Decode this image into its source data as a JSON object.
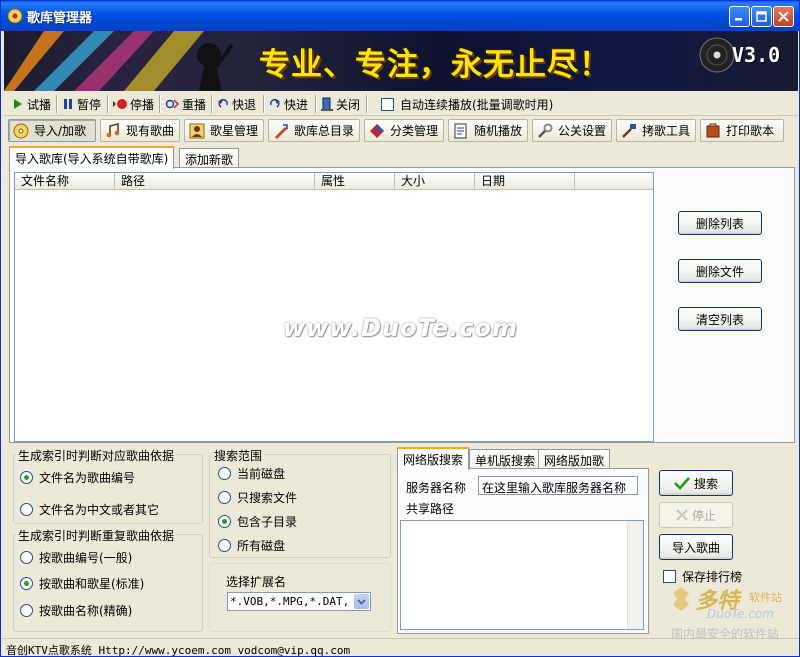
{
  "window": {
    "title": "歌库管理器"
  },
  "banner": {
    "slogan": "专业、专注，永无止尽！",
    "version": "V3.0"
  },
  "toolbar": {
    "items": [
      {
        "label": "试播",
        "icon": "play-icon"
      },
      {
        "label": "暂停",
        "icon": "pause-icon"
      },
      {
        "label": "停播",
        "icon": "stop-icon"
      },
      {
        "label": "重播",
        "icon": "replay-icon"
      },
      {
        "label": "快退",
        "icon": "rewind-icon"
      },
      {
        "label": "快进",
        "icon": "forward-icon"
      },
      {
        "label": "关闭",
        "icon": "close-door-icon"
      }
    ],
    "autoplay_label": "自动连续播放(批量调歌时用)",
    "autoplay_checked": false
  },
  "nav": {
    "items": [
      {
        "label": "导入/加歌",
        "icon": "cd-icon",
        "active": true
      },
      {
        "label": "现有歌曲",
        "icon": "music-icon"
      },
      {
        "label": "歌星管理",
        "icon": "singer-icon"
      },
      {
        "label": "歌库总目录",
        "icon": "catalog-icon"
      },
      {
        "label": "分类管理",
        "icon": "category-icon"
      },
      {
        "label": "随机播放",
        "icon": "shuffle-icon"
      },
      {
        "label": "公关设置",
        "icon": "settings-icon"
      },
      {
        "label": "拷歌工具",
        "icon": "copy-tool-icon"
      },
      {
        "label": "打印歌本",
        "icon": "print-icon"
      }
    ]
  },
  "main_tabs": [
    {
      "label": "导入歌库(导入系统自带歌库)",
      "active": true
    },
    {
      "label": "添加新歌",
      "active": false
    }
  ],
  "file_list": {
    "columns": [
      "文件名称",
      "路径",
      "属性",
      "大小",
      "日期"
    ],
    "rows": []
  },
  "list_actions": {
    "delete_list": "删除列表",
    "delete_file": "删除文件",
    "clear_list": "清空列表"
  },
  "watermark": "www.DuoTe.com",
  "index_basis": {
    "title": "生成索引时判断对应歌曲依据",
    "options": [
      {
        "label": "文件名为歌曲编号",
        "checked": true
      },
      {
        "label": "文件名为中文或者其它",
        "checked": false
      }
    ]
  },
  "dup_basis": {
    "title": "生成索引时判断重复歌曲依据",
    "options": [
      {
        "label": "按歌曲编号(一般)",
        "checked": false
      },
      {
        "label": "按歌曲和歌星(标准)",
        "checked": true
      },
      {
        "label": "按歌曲名称(精确)",
        "checked": false
      }
    ]
  },
  "search_scope": {
    "title": "搜索范围",
    "options": [
      {
        "label": "当前磁盘",
        "checked": false
      },
      {
        "label": "只搜索文件",
        "checked": false
      },
      {
        "label": "包含子目录",
        "checked": true
      },
      {
        "label": "所有磁盘",
        "checked": false
      }
    ]
  },
  "extension": {
    "label": "选择扩展名",
    "value": "*.VOB,*.MPG,*.DAT,*.AVI"
  },
  "search_tabs": [
    {
      "label": "网络版搜索",
      "active": true
    },
    {
      "label": "单机版搜索",
      "active": false
    },
    {
      "label": "网络版加歌",
      "active": false
    }
  ],
  "network": {
    "server_label": "服务器名称",
    "server_value": "在这里输入歌库服务器名称",
    "share_label": "共享路径"
  },
  "actions": {
    "search": "搜索",
    "stop": "停止",
    "import": "导入歌曲",
    "save_rank": "保存排行榜",
    "save_rank_checked": false
  },
  "statusbar": "音创KTV点歌系统 Http://www.ycoem.com vodcom@vip.qq.com",
  "site_logo": {
    "brand": "多特",
    "brand_suffix": "软件站",
    "domain": "DuoTe.com",
    "slogan": "国内最安全的软件站"
  }
}
